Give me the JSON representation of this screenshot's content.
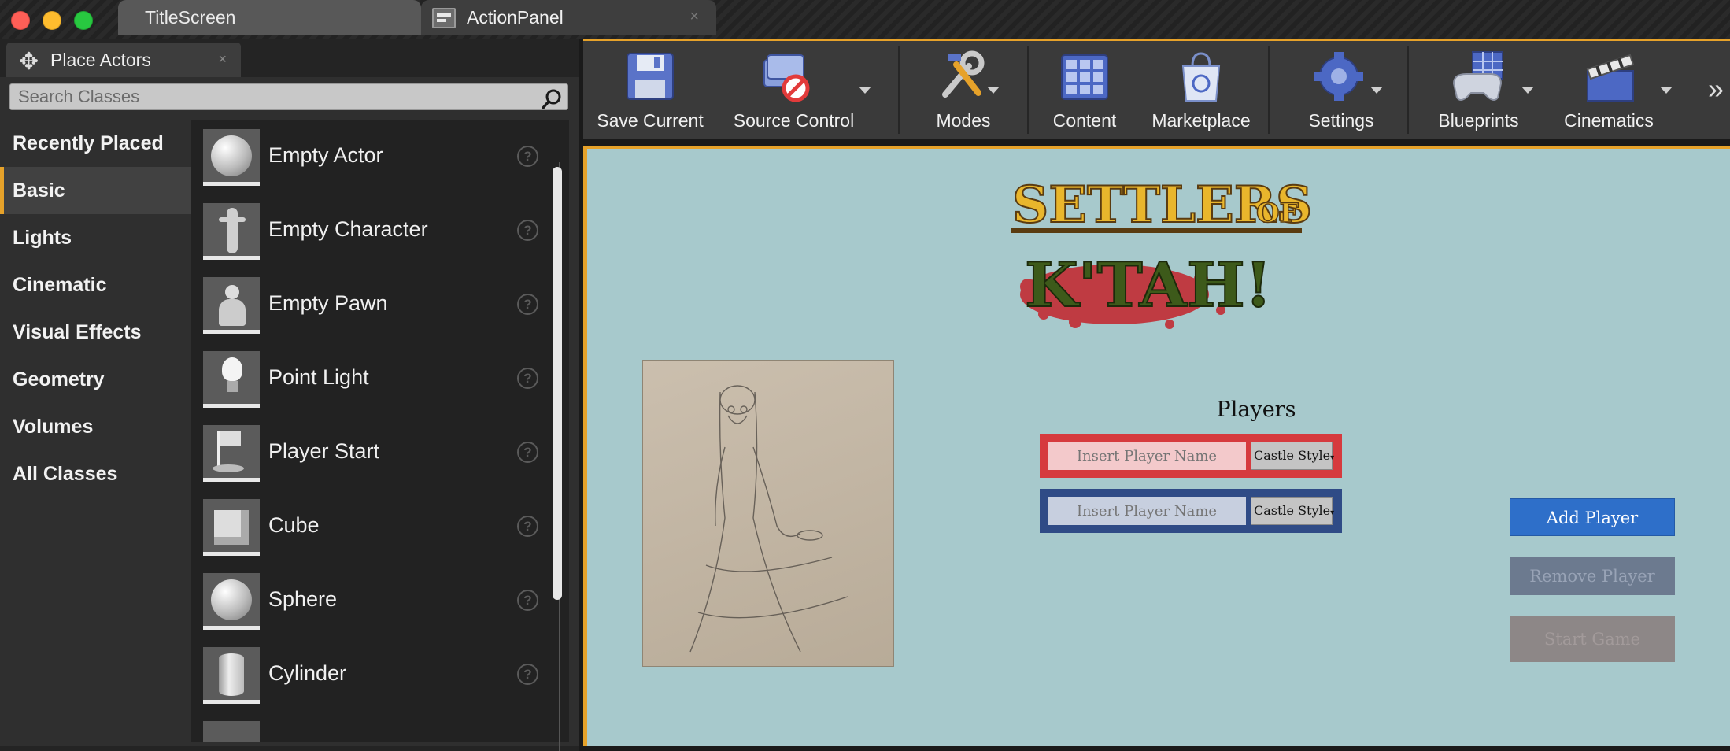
{
  "window": {
    "tabs": [
      {
        "label": "TitleScreen",
        "active": false
      },
      {
        "label": "ActionPanel",
        "active": true,
        "close": "×"
      }
    ]
  },
  "place_actors": {
    "tab_label": "Place Actors",
    "tab_close": "×",
    "search": {
      "placeholder": "Search Classes",
      "value": ""
    },
    "categories": [
      "Recently Placed",
      "Basic",
      "Lights",
      "Cinematic",
      "Visual Effects",
      "Geometry",
      "Volumes",
      "All Classes"
    ],
    "active_category": "Basic",
    "classes": [
      {
        "label": "Empty Actor",
        "icon": "sphere-icon"
      },
      {
        "label": "Empty Character",
        "icon": "character-icon"
      },
      {
        "label": "Empty Pawn",
        "icon": "pawn-icon"
      },
      {
        "label": "Point Light",
        "icon": "lightbulb-icon"
      },
      {
        "label": "Player Start",
        "icon": "flag-icon"
      },
      {
        "label": "Cube",
        "icon": "cube-icon"
      },
      {
        "label": "Sphere",
        "icon": "sphere-icon"
      },
      {
        "label": "Cylinder",
        "icon": "cylinder-icon"
      }
    ],
    "help_glyph": "?"
  },
  "toolbar": {
    "buttons": [
      {
        "label": "Save Current",
        "icon": "floppy-disk-icon",
        "dropdown": false
      },
      {
        "label": "Source Control",
        "icon": "source-control-icon",
        "dropdown": true
      },
      {
        "label": "Modes",
        "icon": "tools-icon",
        "dropdown": true
      },
      {
        "label": "Content",
        "icon": "grid-icon",
        "dropdown": false
      },
      {
        "label": "Marketplace",
        "icon": "shopping-bag-icon",
        "dropdown": false
      },
      {
        "label": "Settings",
        "icon": "gear-icon",
        "dropdown": true
      },
      {
        "label": "Blueprints",
        "icon": "gamepad-icon",
        "dropdown": true
      },
      {
        "label": "Cinematics",
        "icon": "clapperboard-icon",
        "dropdown": true
      }
    ],
    "more_glyph": "»"
  },
  "viewport": {
    "logo": {
      "line1": "SETTLERS",
      "line2": "OF",
      "line3": "K'TAH!"
    },
    "players_title": "Players",
    "player_rows": [
      {
        "placeholder": "Insert Player Name",
        "style": "Castle Style",
        "color": "#d63a3e"
      },
      {
        "placeholder": "Insert Player Name",
        "style": "Castle Style",
        "color": "#2f4b86"
      }
    ],
    "buttons": {
      "add_player": "Add Player",
      "remove_player": "Remove Player",
      "start_game": "Start Game"
    }
  },
  "colors": {
    "accent": "#e6a22a",
    "viewport_bg": "#a7c9cc",
    "add_player": "#2e6fc9"
  }
}
